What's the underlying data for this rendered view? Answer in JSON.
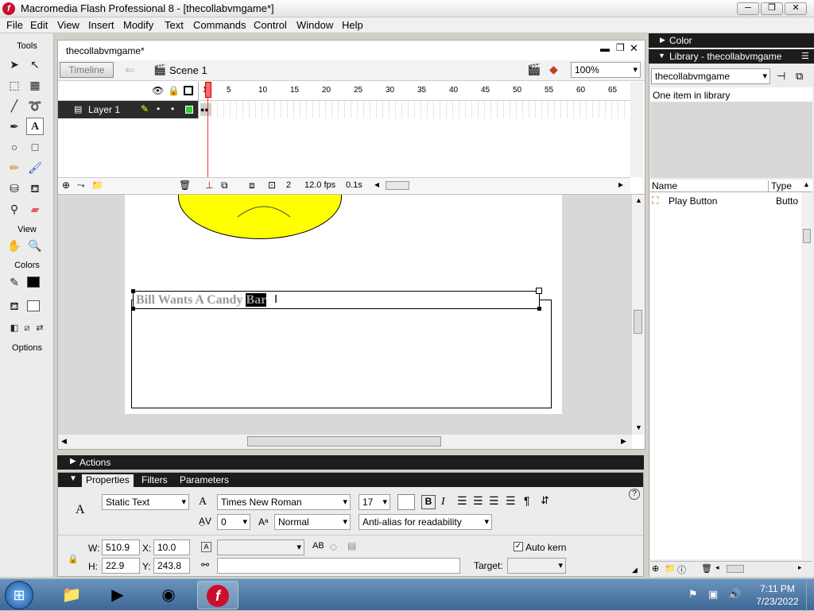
{
  "window": {
    "title": "Macromedia Flash Professional 8 - [thecollabvmgame*]",
    "controls": {
      "minimize": "─",
      "restore": "❐",
      "close": "✕"
    }
  },
  "menu": [
    "File",
    "Edit",
    "View",
    "Insert",
    "Modify",
    "Text",
    "Commands",
    "Control",
    "Window",
    "Help"
  ],
  "tools": {
    "header": "Tools",
    "view_label": "View",
    "colors_label": "Colors",
    "options_label": "Options",
    "stroke_color": "#000000",
    "fill_color": "#ffffff"
  },
  "document": {
    "tab_title": "thecollabvmgame*",
    "timeline_button": "Timeline",
    "scene": "Scene 1",
    "zoom": "100%"
  },
  "timeline": {
    "layer_name": "Layer 1",
    "ruler": [
      "1",
      "5",
      "10",
      "15",
      "20",
      "25",
      "30",
      "35",
      "40",
      "45",
      "50",
      "55",
      "60",
      "65"
    ],
    "current_frame": "2",
    "fps": "12.0 fps",
    "elapsed": "0.1s"
  },
  "stage": {
    "text_plain": "Bill Wants A Candy ",
    "text_selected": "Bar",
    "face_color": "#ffff00"
  },
  "actions_panel": {
    "label": "Actions"
  },
  "properties": {
    "tabs": [
      "Properties",
      "Filters",
      "Parameters"
    ],
    "text_type": "Static Text",
    "font": "Times New Roman",
    "size": "17",
    "letter_spacing": "0",
    "char_position": "Normal",
    "anti_alias": "Anti-alias for readability",
    "w_label": "W:",
    "w": "510.9",
    "h_label": "H:",
    "h": "22.9",
    "x_label": "X:",
    "x": "10.0",
    "y_label": "Y:",
    "y": "243.8",
    "auto_kern_label": "Auto kern",
    "auto_kern": true,
    "target_label": "Target:",
    "bold": "B",
    "italic": "I"
  },
  "right_panel": {
    "color_header": "Color",
    "library_header": "Library - thecollabvmgame",
    "library_select": "thecollabvmgame",
    "item_count": "One item in library",
    "col_name": "Name",
    "col_type": "Type",
    "items": [
      {
        "name": "Play Button",
        "type": "Butto"
      }
    ]
  },
  "taskbar": {
    "time": "7:11 PM",
    "date": "7/23/2022"
  }
}
